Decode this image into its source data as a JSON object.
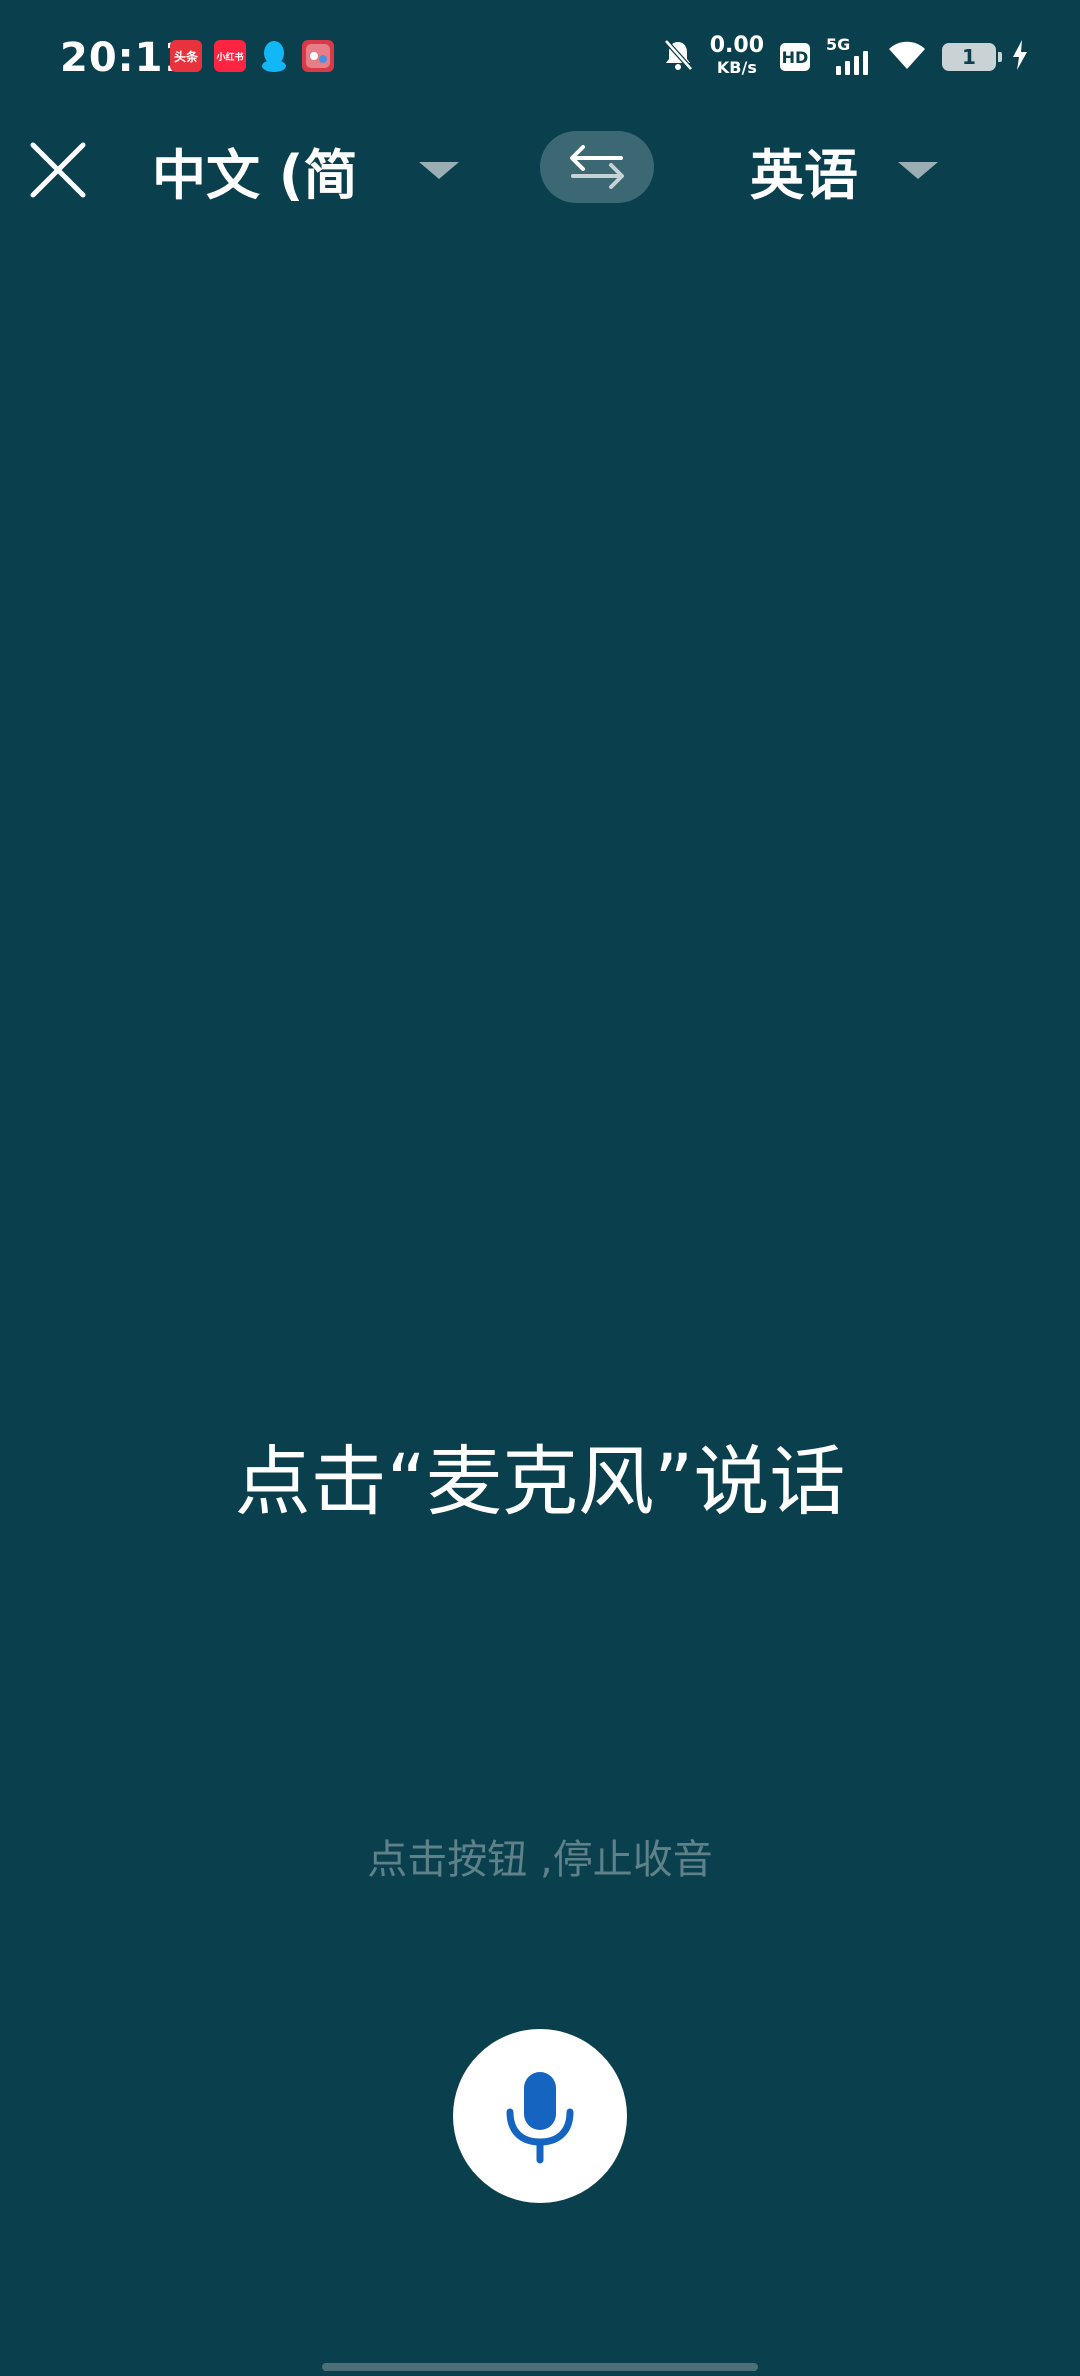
{
  "status_bar": {
    "time": "20:11",
    "notifications": [
      {
        "label": "头条",
        "icon": "toutiao-app-icon"
      },
      {
        "label": "小红书",
        "icon": "xiaohongshu-app-icon"
      },
      {
        "label": "",
        "icon": "qq-penguin-icon"
      },
      {
        "label": "",
        "icon": "game-app-icon"
      }
    ],
    "net_speed_value": "0.00",
    "net_speed_unit": "KB/s",
    "hd_label": "HD",
    "network_label": "5G",
    "battery_level": "1"
  },
  "toolbar": {
    "source_language": "中文 (简",
    "target_language": "英语"
  },
  "main": {
    "prompt": "点击“麦克风”说话",
    "hint": "点击按钮 ,停止收音"
  },
  "colors": {
    "background": "#0a404d",
    "swap_button": "#3b6872",
    "hint_text": "#5e818a",
    "mic_icon": "#1565c0"
  }
}
